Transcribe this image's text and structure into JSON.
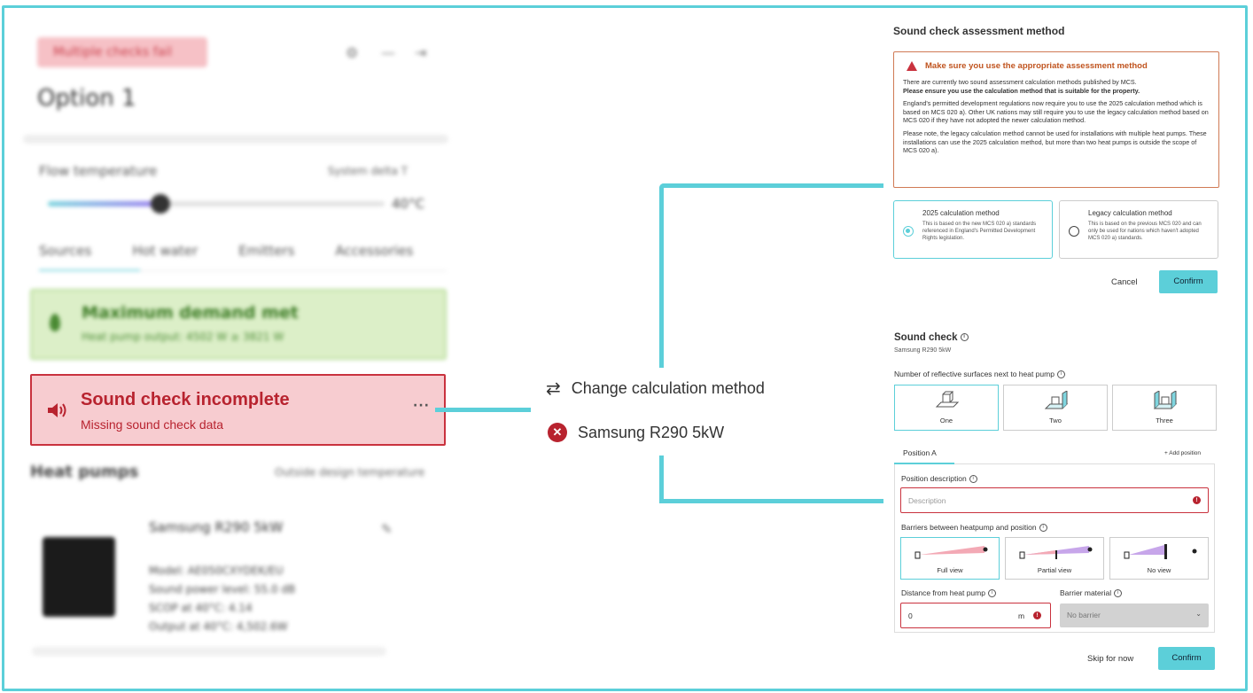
{
  "left_panel": {
    "error_pill": "Multiple checks fail",
    "option_title": "Option 1",
    "flow_temperature_label": "Flow temperature",
    "system_delta": "System delta T",
    "flow_temperature_value": "40°C",
    "tabs": [
      "Sources",
      "Hot water",
      "Emitters",
      "Accessories"
    ],
    "demand_title": "Maximum demand met",
    "demand_sub": "Heat pump output: 4502 W ≥ 3821 W",
    "sound_card": {
      "title": "Sound check incomplete",
      "subtitle": "Missing sound check data",
      "more": "···"
    },
    "heat_pumps_title": "Heat pumps",
    "outside_design_temperature": "Outside design temperature",
    "heat_pump": {
      "name": "Samsung R290 5kW",
      "model": "Model: AE050CXYDEK/EU",
      "sound_power": "Sound power level: 55.0 dB",
      "scop": "SCOP at 40°C: 4.14",
      "output": "Output at 40°C: 4,502.6W"
    }
  },
  "center": {
    "change_method": "Change calculation method",
    "heat_pump_error": "Samsung R290 5kW"
  },
  "assessment_modal": {
    "title": "Sound check assessment method",
    "warning_title": "Make sure you use the appropriate assessment method",
    "warning_p1": "There are currently two sound assessment calculation methods published by MCS.",
    "warning_p1_bold": "Please ensure you use the calculation method that is suitable for the property.",
    "warning_p2": "England's permitted development regulations now require you to use the 2025 calculation method which is based on MCS 020 a). Other UK nations may still require you to use the legacy calculation method based on MCS 020 if they have not adopted the newer calculation method.",
    "warning_p3": "Please note, the legacy calculation method cannot be used for installations with multiple heat pumps. These installations can use the 2025 calculation method, but more than two heat pumps is outside the scope of MCS 020 a).",
    "methods": [
      {
        "title": "2025 calculation method",
        "desc": "This is based on the new MCS 020 a) standards referenced in England's Permitted Development Rights legislation.",
        "selected": true
      },
      {
        "title": "Legacy calculation method",
        "desc": "This is based on the previous MCS 020 and can only be used for nations which haven't adopted MCS 020 a) standards.",
        "selected": false
      }
    ],
    "cancel": "Cancel",
    "confirm": "Confirm"
  },
  "sound_check_modal": {
    "title": "Sound check",
    "subtitle": "Samsung R290 5kW",
    "surfaces_label": "Number of reflective surfaces next to heat pump",
    "surfaces": [
      "One",
      "Two",
      "Three"
    ],
    "position_tab": "Position A",
    "add_position": "+ Add position",
    "position_description_label": "Position description",
    "position_description_placeholder": "Description",
    "barriers_label": "Barriers between heatpump and position",
    "barriers": [
      "Full view",
      "Partial view",
      "No view"
    ],
    "distance_label": "Distance from heat pump",
    "distance_value": "0",
    "distance_unit": "m",
    "material_label": "Barrier material",
    "material_value": "No barrier",
    "skip": "Skip for now",
    "confirm": "Confirm"
  },
  "colors": {
    "accent": "#5ccfd9",
    "error": "#b8232f",
    "error_bg": "#f7ccd0",
    "warning": "#c0541f"
  }
}
